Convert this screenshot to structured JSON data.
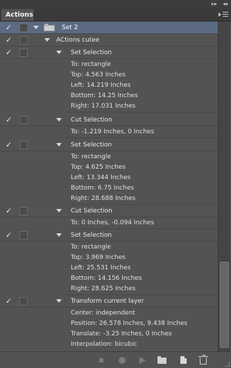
{
  "panel": {
    "tab_label": "Actions",
    "collapse_glyph": "◂◂",
    "close_glyph": "▸▸"
  },
  "rows": {
    "set2": {
      "label": "Set 2"
    },
    "actions_cutee": {
      "label": "ACtions cutee"
    },
    "step1": {
      "label": "Set Selection",
      "details": [
        "To: rectangle",
        "Top: 4.563 Inches",
        "Left: 14.219 Inches",
        "Bottom: 14.25 Inches",
        "Right: 17.031 Inches"
      ]
    },
    "step2": {
      "label": "Cut Selection",
      "details": [
        "To: -1.219 Inches, 0 Inches"
      ]
    },
    "step3": {
      "label": "Set Selection",
      "details": [
        "To: rectangle",
        "Top: 4.625 Inches",
        "Left: 13.344 Inches",
        "Bottom: 6.75 Inches",
        "Right: 28.688 Inches"
      ]
    },
    "step4": {
      "label": "Cut Selection",
      "details": [
        "To: 0 Inches, -0.094 Inches"
      ]
    },
    "step5": {
      "label": "Set Selection",
      "details": [
        "To: rectangle",
        "Top: 3.969 Inches",
        "Left: 25.531 Inches",
        "Bottom: 14.156 Inches",
        "Right: 28.625 Inches"
      ]
    },
    "step6": {
      "label": "Transform current layer",
      "details": [
        "Center: independent",
        "Position: 26.578 Inches, 9.438 Inches",
        "Translate: -3.25 Inches, 0 Inches",
        "Interpolation: bicubic"
      ]
    }
  },
  "check_glyph": "✓",
  "icons": {
    "toolbar": [
      "stop-icon",
      "record-icon",
      "play-icon",
      "new-set-icon",
      "new-action-icon",
      "delete-icon"
    ]
  },
  "colors": {
    "panel_bg": "#535353",
    "selected_row": "#5b6a82",
    "text": "#e0e0e0"
  }
}
